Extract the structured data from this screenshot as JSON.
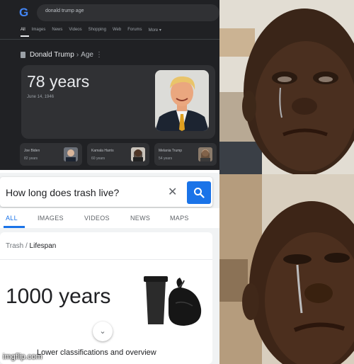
{
  "dark_panel": {
    "logo": "G",
    "search_query": "donald trump age",
    "tabs": [
      "All",
      "Images",
      "News",
      "Videos",
      "Shopping",
      "Web",
      "Forums",
      "More ▾"
    ],
    "breadcrumb": {
      "name": "Donald Trump",
      "separator": "›",
      "attribute": "Age",
      "more": "⋮"
    },
    "answer": "78 years",
    "birth_date": "June 14, 1946",
    "related": [
      {
        "name": "Joe Biden",
        "age": "82 years"
      },
      {
        "name": "Kamala Harris",
        "age": "60 years"
      },
      {
        "name": "Melania Trump",
        "age": "54 years"
      }
    ]
  },
  "light_panel": {
    "search_query": "How long does trash live?",
    "clear_glyph": "✕",
    "tabs": [
      "ALL",
      "IMAGES",
      "VIDEOS",
      "NEWS",
      "MAPS"
    ],
    "breadcrumb_entity": "Trash",
    "breadcrumb_sep": " / ",
    "breadcrumb_attribute": "Lifespan",
    "answer": "1000 years",
    "expand_glyph": "⌄",
    "bottom_text": "Lower classifications and overview"
  },
  "watermark": "imgflip.com",
  "colors": {
    "google_blue": "#1a73e8",
    "dark_bg": "#202124",
    "dark_card": "#303134"
  },
  "icons": [
    "google-logo-icon",
    "search-icon",
    "clear-icon",
    "chevron-down-icon",
    "trash-bag-icon"
  ]
}
